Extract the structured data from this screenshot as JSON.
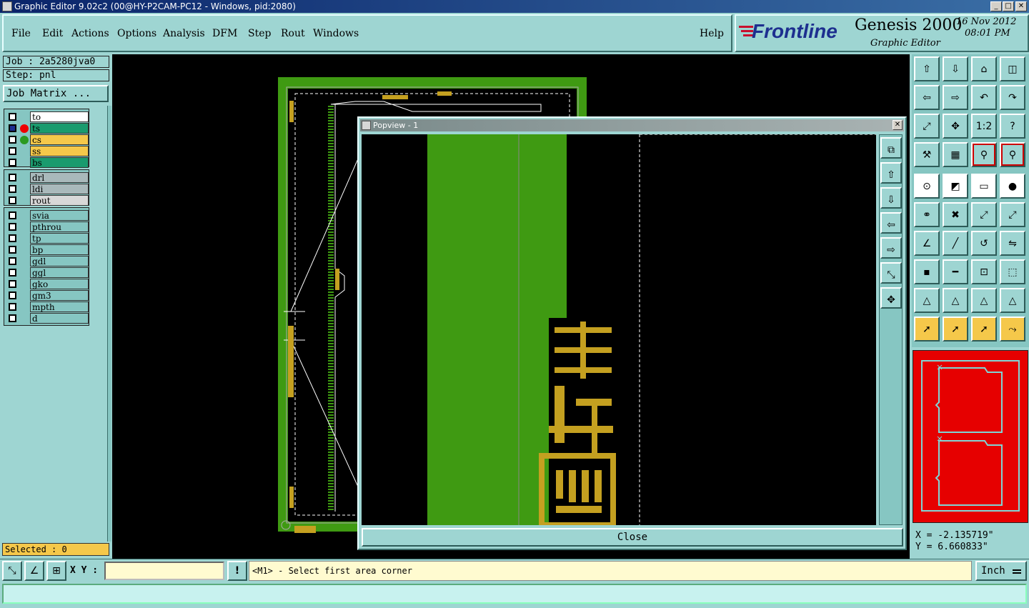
{
  "window": {
    "title": "Graphic Editor 9.02c2 (00@HY-P2CAM-PC12 - Windows, pid:2080)",
    "minimize": "_",
    "maximize": "□",
    "close": "✕"
  },
  "menu": {
    "items": [
      "File",
      "Edit",
      "Actions",
      "Options",
      "Analysis",
      "DFM",
      "Step",
      "Rout",
      "Windows"
    ],
    "help": "Help"
  },
  "branding": {
    "company": "Frontline",
    "product": "Genesis 2000",
    "subtitle": "Graphic Editor",
    "date": "16 Nov 2012",
    "time": "08:01 PM"
  },
  "job": {
    "job_label": "Job : 2a5280jva0",
    "step_label": "Step: pnl",
    "matrix_button": "Job Matrix ..."
  },
  "layers": {
    "group1": [
      {
        "name": "to",
        "color": "#ffffff"
      },
      {
        "name": "ts",
        "color": "#1a9b6e"
      },
      {
        "name": "cs",
        "color": "#f5c84a"
      },
      {
        "name": "ss",
        "color": "#f5c84a"
      },
      {
        "name": "bs",
        "color": "#1a9b6e"
      }
    ],
    "group2": [
      {
        "name": "drl",
        "color": "#a9b9bb"
      },
      {
        "name": "ldi",
        "color": "#a9b9bb"
      },
      {
        "name": "rout",
        "color": "#d8d8d8"
      }
    ],
    "group3": [
      {
        "name": "svia",
        "color": "#86c6c2"
      },
      {
        "name": "pthrou",
        "color": "#86c6c2"
      },
      {
        "name": "tp",
        "color": "#86c6c2"
      },
      {
        "name": "bp",
        "color": "#86c6c2"
      },
      {
        "name": "gdl",
        "color": "#86c6c2"
      },
      {
        "name": "ggl",
        "color": "#86c6c2"
      },
      {
        "name": "gko",
        "color": "#86c6c2"
      },
      {
        "name": "gm3",
        "color": "#86c6c2"
      },
      {
        "name": "mpth",
        "color": "#86c6c2"
      },
      {
        "name": "d",
        "color": "#86c6c2"
      }
    ]
  },
  "selected_label": "Selected : 0",
  "popview": {
    "title": "Popview - 1",
    "close_button": "Close",
    "x_btn": "✕"
  },
  "coords": {
    "x": "X = -2.135719\"",
    "y": "Y = 6.660833\""
  },
  "status": {
    "xy_label": "X Y :",
    "xy_value": "",
    "warn": "!",
    "prompt": "<M1> - Select first area corner",
    "units": "Inch"
  },
  "toolbar": {
    "icons": [
      "home-up-icon",
      "home-down-icon",
      "home-icon",
      "split-view-icon",
      "pan-left-icon",
      "pan-right-icon",
      "undo-icon",
      "redo-icon",
      "zoom-fit-icon",
      "zoom-center-icon",
      "one-to-two-icon",
      "help-icon",
      "measure-tool-icon",
      "grid-icon",
      "layer-compare-icon",
      "layer-compare-2-icon",
      "snap-icon",
      "edit-shape-icon",
      "ruler-icon",
      "pad-icon",
      "connect-icon",
      "delete-icon",
      "move-point-icon",
      "move-point-2-icon",
      "angle-icon",
      "line-icon",
      "arc-icon",
      "flip-icon",
      "add-pad-icon",
      "minus-icon",
      "resize-icon",
      "shapes-icon",
      "triangle-icon",
      "triangle-2-icon",
      "triangle-3-icon",
      "triangle-4-icon",
      "pointer-icon",
      "pointer-box-icon",
      "pointer-circle-icon",
      "route-icon"
    ],
    "one_to_two": "1:2",
    "help_q": "?"
  }
}
